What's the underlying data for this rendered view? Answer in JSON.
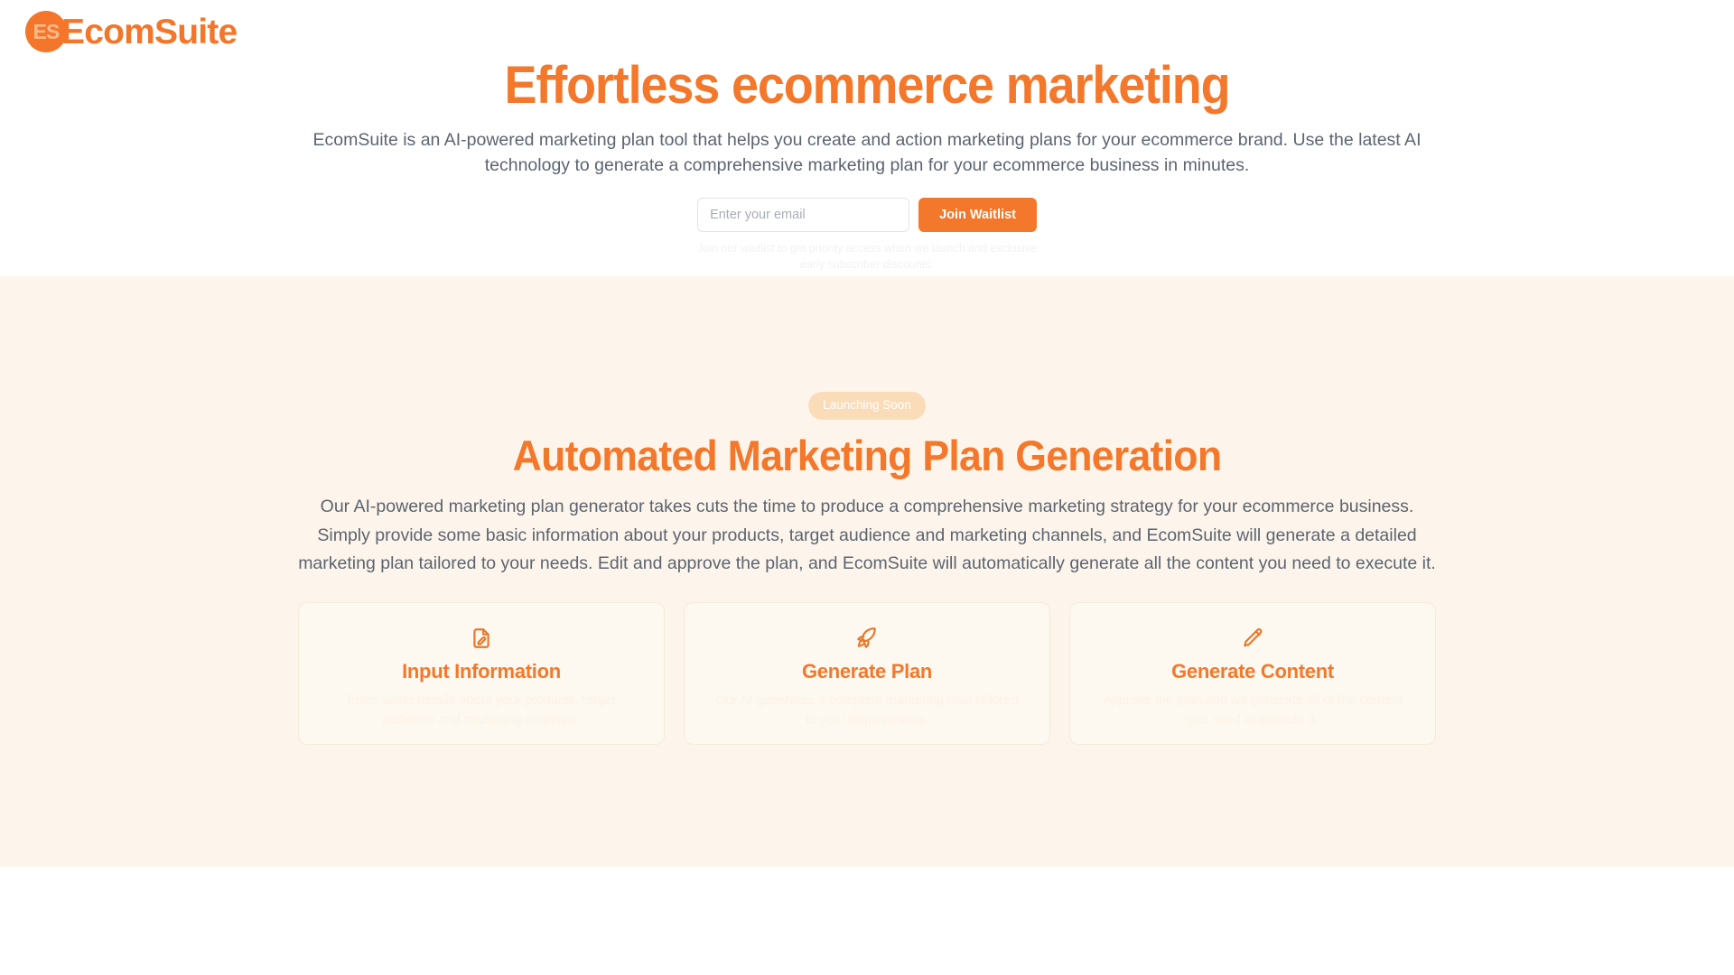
{
  "brand": {
    "badge_initials": "ES",
    "name": "EcomSuite",
    "accent_color": "#f4782b",
    "cream_bg": "#fdf5eb"
  },
  "hero": {
    "title": "Effortless ecommerce marketing",
    "subtitle": "EcomSuite is an AI-powered marketing plan tool that helps you create and action marketing plans for your ecommerce brand. Use the latest AI technology to generate a comprehensive marketing plan for your ecommerce business in minutes.",
    "form": {
      "email_placeholder": "Enter your email",
      "email_value": "",
      "submit_label": "Join Waitlist",
      "note": "Join our waitlist to get priority access when we launch and exclusive early subscriber discounts."
    }
  },
  "features": {
    "badge": "Launching Soon",
    "title": "Automated Marketing Plan Generation",
    "body": "Our AI-powered marketing plan generator takes cuts the time to produce a comprehensive marketing strategy for your ecommerce business. Simply provide some basic information about your products, target audience and marketing channels, and EcomSuite will generate a detailed marketing plan tailored to your needs. Edit and approve the plan, and EcomSuite will automatically generate all the content you need to execute it.",
    "cards": [
      {
        "icon": "document-edit-icon",
        "title": "Input Information",
        "desc": "Enter some details about your products, target audience and marketing channels."
      },
      {
        "icon": "rocket-icon",
        "title": "Generate Plan",
        "desc": "Our AI generates a complete marketing plan tailored to your requirements."
      },
      {
        "icon": "pencil-icon",
        "title": "Generate Content",
        "desc": "Approve the plan and we generate all of the content you need to execute it."
      }
    ]
  }
}
